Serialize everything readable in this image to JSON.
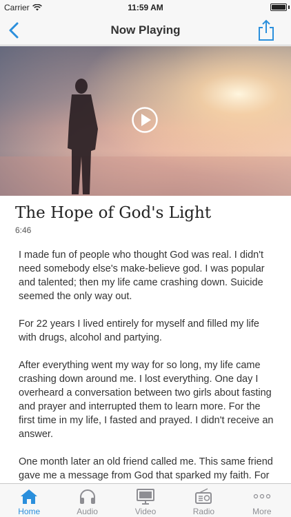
{
  "status_bar": {
    "carrier": "Carrier",
    "time": "11:59 AM"
  },
  "nav": {
    "title": "Now Playing",
    "back_icon": "chevron-left-icon",
    "share_icon": "share-icon"
  },
  "colors": {
    "accent": "#2a8fdc",
    "inactive": "#8e8e93",
    "bar_bg": "#f7f7f7"
  },
  "video": {
    "play_icon": "play-icon"
  },
  "article": {
    "title": "The Hope of God's Light",
    "duration": "6:46",
    "paragraphs": [
      "I made fun of people who thought God was real. I didn't need somebody else's make-believe god.  I was popular and talented; then my life came crashing down. Suicide seemed the only way out.",
      "For 22 years I lived entirely for myself and filled my life with drugs, alcohol and partying.",
      "After everything went my way for so long, my life came crashing down around me.  I lost everything. One day I overheard a conversation between two girls about fasting and prayer and interrupted them to learn more. For the first time in my life, I fasted and prayed.  I didn't receive an answer.",
      "One month later an old friend called me.  This same friend gave me a message from God that sparked my faith. For the next year and a half I faithfully attended"
    ]
  },
  "tabs": [
    {
      "label": "Home",
      "icon": "home-icon",
      "active": true
    },
    {
      "label": "Audio",
      "icon": "headphones-icon",
      "active": false
    },
    {
      "label": "Video",
      "icon": "tv-icon",
      "active": false
    },
    {
      "label": "Radio",
      "icon": "radio-icon",
      "active": false
    },
    {
      "label": "More",
      "icon": "more-icon",
      "active": false
    }
  ]
}
